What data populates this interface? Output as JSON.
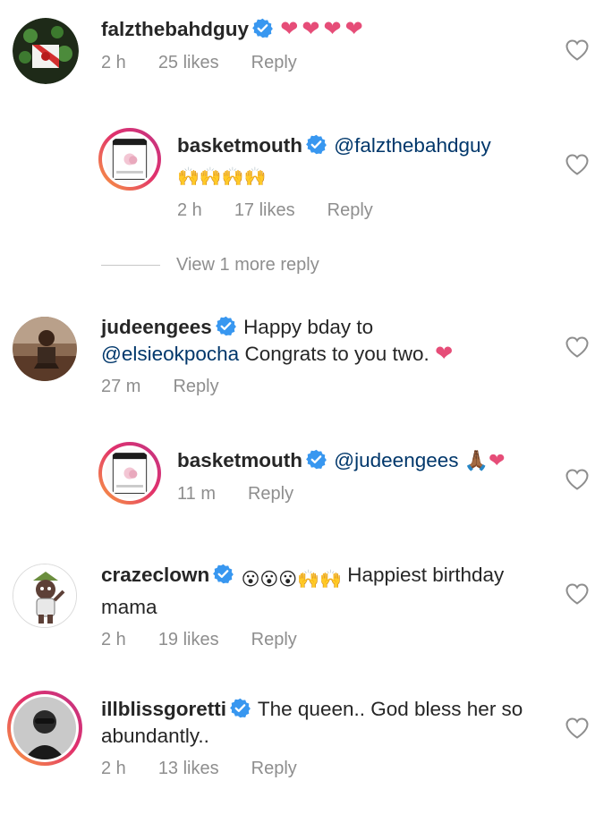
{
  "comments": [
    {
      "username": "falzthebahdguy",
      "text": "❤❤❤❤",
      "time": "2 h",
      "likes": "25 likes",
      "reply": "Reply"
    },
    {
      "username": "basketmouth",
      "mention": "@falzthebahdguy",
      "text": "🙌🙌🙌🙌",
      "time": "2 h",
      "likes": "17 likes",
      "reply": "Reply"
    },
    {
      "view_more": "View 1 more reply"
    },
    {
      "username": "judeengees",
      "text_pre": "Happy bday to",
      "mention": "@elsieokpocha",
      "text_post": "Congrats to you two.",
      "heart": "❤",
      "time": "27 m",
      "reply": "Reply"
    },
    {
      "username": "basketmouth",
      "mention": "@judeengees",
      "text": "🙏🏾❤",
      "time": "11 m",
      "reply": "Reply"
    },
    {
      "username": "crazeclown",
      "text_emoji": "😮😮😮🙌🙌",
      "text": "Happiest birthday mama",
      "time": "2 h",
      "likes": "19 likes",
      "reply": "Reply"
    },
    {
      "username": "illblissgoretti",
      "text": "The queen.. God bless her so abundantly..",
      "time": "2 h",
      "likes": "13 likes",
      "reply": "Reply"
    }
  ],
  "colors": {
    "verified": "#3897f0",
    "mention": "#00376b",
    "meta": "#8e8e8e",
    "heart": "#e64d78"
  },
  "icons": {
    "like": "heart-outline-icon",
    "verified": "verified-badge-icon"
  }
}
